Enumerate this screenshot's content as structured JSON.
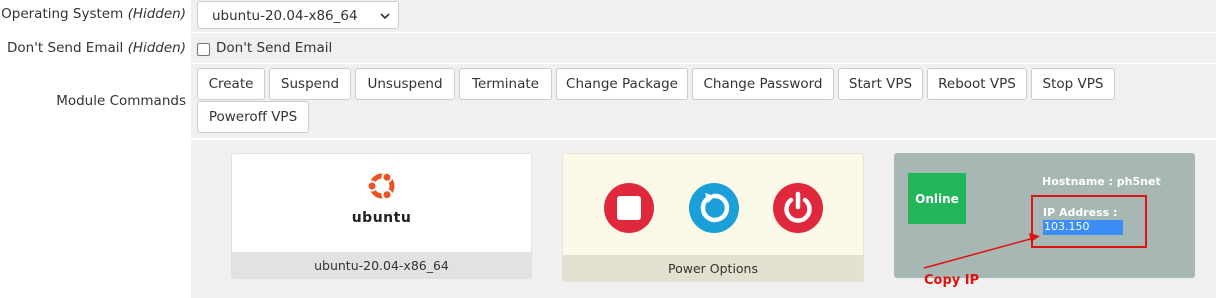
{
  "os_row": {
    "label": "Operating System",
    "hidden_tag": "(Hidden)",
    "selected": "ubuntu-20.04-x86_64"
  },
  "email_row": {
    "label": "Don't Send Email",
    "hidden_tag": "(Hidden)",
    "checkbox_label": "Don't Send Email",
    "checked": false
  },
  "module_row": {
    "label": "Module Commands",
    "buttons": [
      "Create",
      "Suspend",
      "Unsuspend",
      "Terminate",
      "Change Package",
      "Change Password",
      "Start VPS",
      "Reboot VPS",
      "Stop VPS",
      "Poweroff VPS"
    ]
  },
  "os_card": {
    "logo_text": "ubuntu",
    "caption": "ubuntu-20.04-x86_64"
  },
  "power_card": {
    "caption": "Power Options"
  },
  "status_card": {
    "status": "Online",
    "hostname": "Hostname : ph5net",
    "ip_label": "IP Address :",
    "ip_value": "103.150",
    "annotation": "Copy IP"
  },
  "colors": {
    "online": "#22b55a",
    "power_red": "#e0283d",
    "restart_blue": "#1a9fd9",
    "annotation_red": "#e21111"
  }
}
